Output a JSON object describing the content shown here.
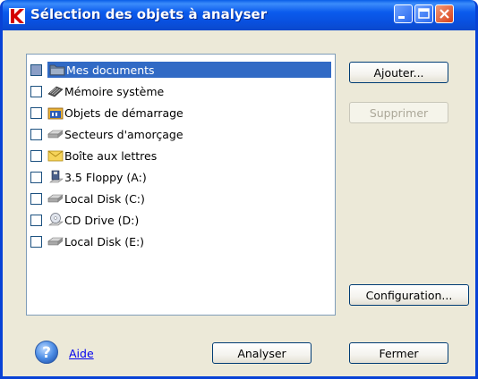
{
  "window": {
    "title": "Sélection des objets à analyser",
    "accent": "#0a5fe8"
  },
  "objects": [
    {
      "label": "Mes documents",
      "icon": "folder-icon",
      "checked": false,
      "selected": true
    },
    {
      "label": "Mémoire système",
      "icon": "memory-chip-icon",
      "checked": false,
      "selected": false
    },
    {
      "label": "Objets de démarrage",
      "icon": "startup-objects-icon",
      "checked": false,
      "selected": false
    },
    {
      "label": "Secteurs d'amorçage",
      "icon": "disk-drive-icon",
      "checked": false,
      "selected": false
    },
    {
      "label": "Boîte aux lettres",
      "icon": "envelope-icon",
      "checked": false,
      "selected": false
    },
    {
      "label": "3.5 Floppy (A:)",
      "icon": "floppy-drive-icon",
      "checked": false,
      "selected": false
    },
    {
      "label": "Local Disk (C:)",
      "icon": "disk-drive-icon",
      "checked": false,
      "selected": false
    },
    {
      "label": "CD Drive (D:)",
      "icon": "cd-drive-icon",
      "checked": false,
      "selected": false
    },
    {
      "label": "Local Disk (E:)",
      "icon": "disk-drive-icon",
      "checked": false,
      "selected": false
    }
  ],
  "buttons": {
    "add": "Ajouter...",
    "remove": "Supprimer",
    "config": "Configuration...",
    "scan": "Analyser",
    "close": "Fermer"
  },
  "help": {
    "label": "Aide"
  }
}
